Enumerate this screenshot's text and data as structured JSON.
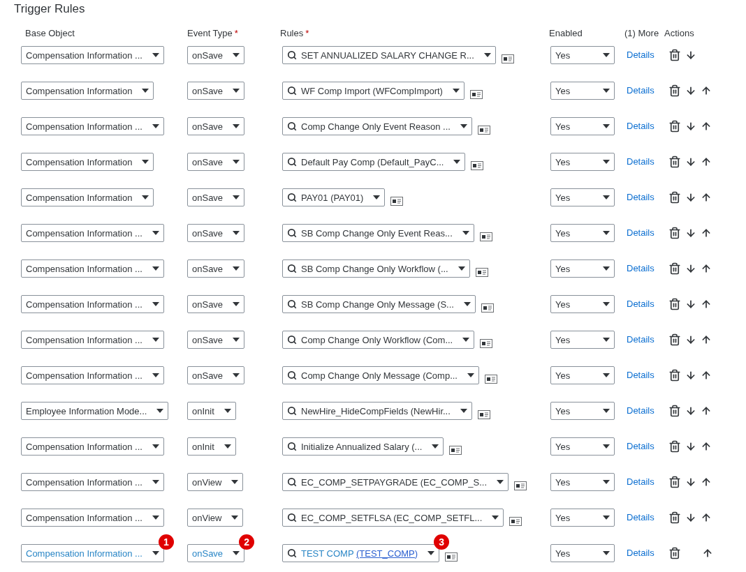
{
  "title": "Trigger Rules",
  "columns": [
    {
      "label": "Base Object"
    },
    {
      "label": "Event Type",
      "required_mark": "*"
    },
    {
      "label": "Rules",
      "required_mark": "*"
    },
    {
      "label": "Enabled"
    },
    {
      "label": "(1) More"
    },
    {
      "label": "Actions"
    }
  ],
  "rows": [
    {
      "base_object": "Compensation Information ...",
      "event_type": "onSave",
      "rule": "SET ANNUALIZED SALARY CHANGE R...",
      "enabled": "Yes",
      "action_link": "Details",
      "can_move_down": true,
      "can_move_up": false,
      "highlighted": false
    },
    {
      "base_object": "Compensation Information",
      "event_type": "onSave",
      "rule": "WF Comp Import (WFCompImport)",
      "enabled": "Yes",
      "action_link": "Details",
      "can_move_down": true,
      "can_move_up": true,
      "highlighted": false
    },
    {
      "base_object": "Compensation Information ...",
      "event_type": "onSave",
      "rule": "Comp Change Only Event Reason ...",
      "enabled": "Yes",
      "action_link": "Details",
      "can_move_down": true,
      "can_move_up": true,
      "highlighted": false
    },
    {
      "base_object": "Compensation Information",
      "event_type": "onSave",
      "rule": "Default Pay Comp (Default_PayC...",
      "enabled": "Yes",
      "action_link": "Details",
      "can_move_down": true,
      "can_move_up": true,
      "highlighted": false
    },
    {
      "base_object": "Compensation Information",
      "event_type": "onSave",
      "rule": "PAY01 (PAY01)",
      "enabled": "Yes",
      "action_link": "Details",
      "can_move_down": true,
      "can_move_up": true,
      "highlighted": false
    },
    {
      "base_object": "Compensation Information ...",
      "event_type": "onSave",
      "rule": "SB Comp Change Only Event Reas...",
      "enabled": "Yes",
      "action_link": "Details",
      "can_move_down": true,
      "can_move_up": true,
      "highlighted": false
    },
    {
      "base_object": "Compensation Information ...",
      "event_type": "onSave",
      "rule": "SB Comp Change Only Workflow (...",
      "enabled": "Yes",
      "action_link": "Details",
      "can_move_down": true,
      "can_move_up": true,
      "highlighted": false
    },
    {
      "base_object": "Compensation Information ...",
      "event_type": "onSave",
      "rule": "SB Comp Change Only Message (S...",
      "enabled": "Yes",
      "action_link": "Details",
      "can_move_down": true,
      "can_move_up": true,
      "highlighted": false
    },
    {
      "base_object": "Compensation Information ...",
      "event_type": "onSave",
      "rule": "Comp Change Only Workflow (Com...",
      "enabled": "Yes",
      "action_link": "Details",
      "can_move_down": true,
      "can_move_up": true,
      "highlighted": false
    },
    {
      "base_object": "Compensation Information ...",
      "event_type": "onSave",
      "rule": "Comp Change Only Message (Comp...",
      "enabled": "Yes",
      "action_link": "Details",
      "can_move_down": true,
      "can_move_up": true,
      "highlighted": false
    },
    {
      "base_object": "Employee Information Mode...",
      "event_type": "onInit",
      "rule": "NewHire_HideCompFields (NewHir...",
      "enabled": "Yes",
      "action_link": "Details",
      "can_move_down": true,
      "can_move_up": true,
      "highlighted": false
    },
    {
      "base_object": "Compensation Information ...",
      "event_type": "onInit",
      "rule": "Initialize Annualized Salary (...",
      "enabled": "Yes",
      "action_link": "Details",
      "can_move_down": true,
      "can_move_up": true,
      "highlighted": false
    },
    {
      "base_object": "Compensation Information ...",
      "event_type": "onView",
      "rule": "EC_COMP_SETPAYGRADE (EC_COMP_S...",
      "enabled": "Yes",
      "action_link": "Details",
      "can_move_down": true,
      "can_move_up": true,
      "highlighted": false
    },
    {
      "base_object": "Compensation Information ...",
      "event_type": "onView",
      "rule": "EC_COMP_SETFLSA (EC_COMP_SETFL...",
      "enabled": "Yes",
      "action_link": "Details",
      "can_move_down": true,
      "can_move_up": true,
      "highlighted": false
    },
    {
      "base_object": "Compensation Information ...",
      "base_badge": "1",
      "event_type": "onSave",
      "event_badge": "2",
      "rule": "TEST COMP",
      "rule_link": "(TEST_COMP)",
      "rule_badge": "3",
      "enabled": "Yes",
      "action_link": "Details",
      "can_move_down": false,
      "can_move_up": true,
      "highlighted": true
    }
  ]
}
